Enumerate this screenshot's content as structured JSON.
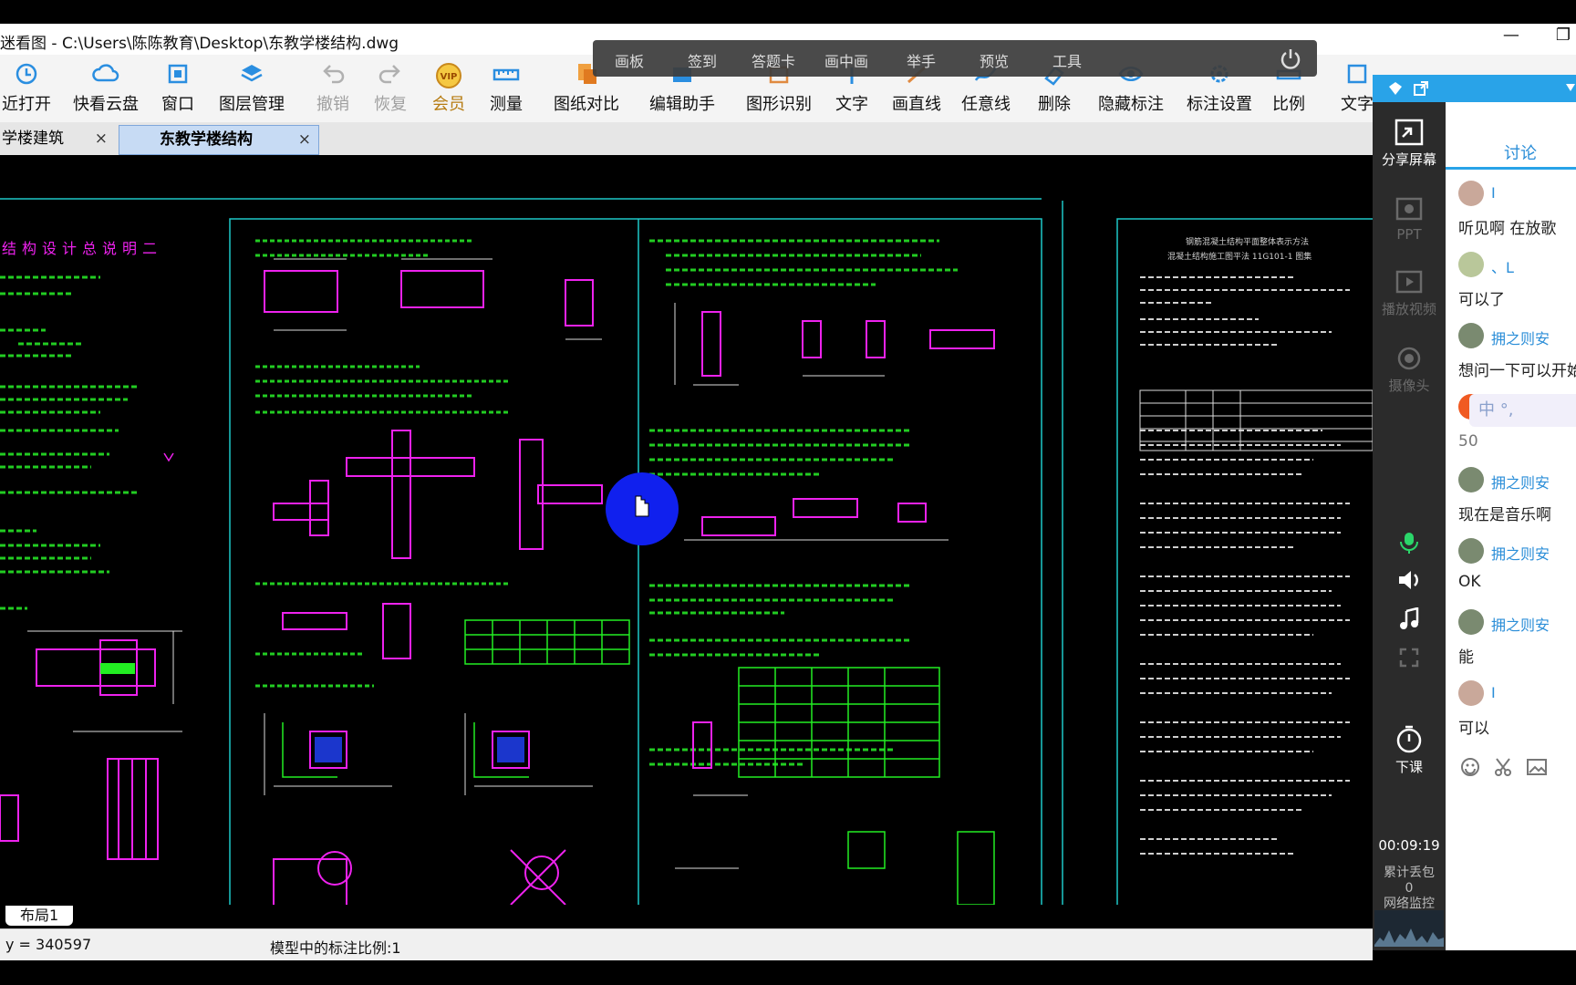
{
  "window": {
    "title": "迷看图 - C:\\Users\\陈陈教育\\Desktop\\东教学楼结构.dwg",
    "minimize": "—",
    "restore": "❐"
  },
  "ribbon": {
    "items": [
      {
        "label": "近打开",
        "icon": "clock-icon"
      },
      {
        "label": "快看云盘",
        "icon": "cloud-icon"
      },
      {
        "label": "窗口",
        "icon": "window-icon"
      },
      {
        "label": "图层管理",
        "icon": "layers-icon"
      },
      {
        "label": "撤销",
        "icon": "undo-icon"
      },
      {
        "label": "恢复",
        "icon": "redo-icon"
      },
      {
        "label": "会员",
        "icon": "vip-icon"
      },
      {
        "label": "测量",
        "icon": "ruler-icon"
      },
      {
        "label": "图纸对比",
        "icon": "compare-icon"
      },
      {
        "label": "编辑助手",
        "icon": "edit-icon"
      },
      {
        "label": "图形识别",
        "icon": "recognize-icon"
      },
      {
        "label": "文字",
        "icon": "text-icon"
      },
      {
        "label": "画直线",
        "icon": "line-icon"
      },
      {
        "label": "任意线",
        "icon": "freeline-icon"
      },
      {
        "label": "删除",
        "icon": "eraser-icon"
      },
      {
        "label": "隐藏标注",
        "icon": "eye-icon"
      },
      {
        "label": "标注设置",
        "icon": "gear-icon"
      },
      {
        "label": "比例",
        "icon": "scale-icon"
      },
      {
        "label": "文字",
        "icon": "text2-icon"
      }
    ],
    "vip_badge": "VIP"
  },
  "float_bar": {
    "items": [
      "画板",
      "签到",
      "答题卡",
      "画中画",
      "举手",
      "预览",
      "工具"
    ]
  },
  "tabs": [
    {
      "label": "学楼建筑",
      "close": "×"
    },
    {
      "label": "东教学楼结构",
      "close": "×"
    }
  ],
  "drawing": {
    "left_title": "结构设计总说明二",
    "right_sheet_heading": "钢筋混凝土结构平面整体表示方法",
    "right_sheet_sub": "混凝土结构施工图平法 11G101-1 图集"
  },
  "layout_tab": "布局1",
  "status": {
    "coord": "y = 340597",
    "scale": "模型中的标注比例:1"
  },
  "side_toolbar": {
    "share": "分享屏幕",
    "ppt": "PPT",
    "video": "播放视频",
    "camera": "摄像头",
    "end_class": "下课",
    "timer": "00:09:19",
    "lost_label": "累计丢包",
    "lost_value": "0",
    "net_label": "网络监控"
  },
  "chat": {
    "tab": "讨论",
    "messages": [
      {
        "name": "I",
        "text": "听见啊 在放歌"
      },
      {
        "name": "、L",
        "text": "可以了"
      },
      {
        "name": "拥之则安",
        "text": "想问一下可以开始"
      },
      {
        "name": "",
        "text": "50"
      },
      {
        "name": "拥之则安",
        "text": "现在是音乐啊"
      },
      {
        "name": "拥之则安",
        "text": "OK"
      },
      {
        "name": "拥之则安",
        "text": "能"
      },
      {
        "name": "I",
        "text": "可以"
      }
    ],
    "ime": "中 °,"
  },
  "colors": {
    "accent": "#29a3e8",
    "cad_green": "#22ee22",
    "cad_magenta": "#ee22ee",
    "cad_frame": "#1ec8c8",
    "cursor_blue": "#1020ee"
  }
}
